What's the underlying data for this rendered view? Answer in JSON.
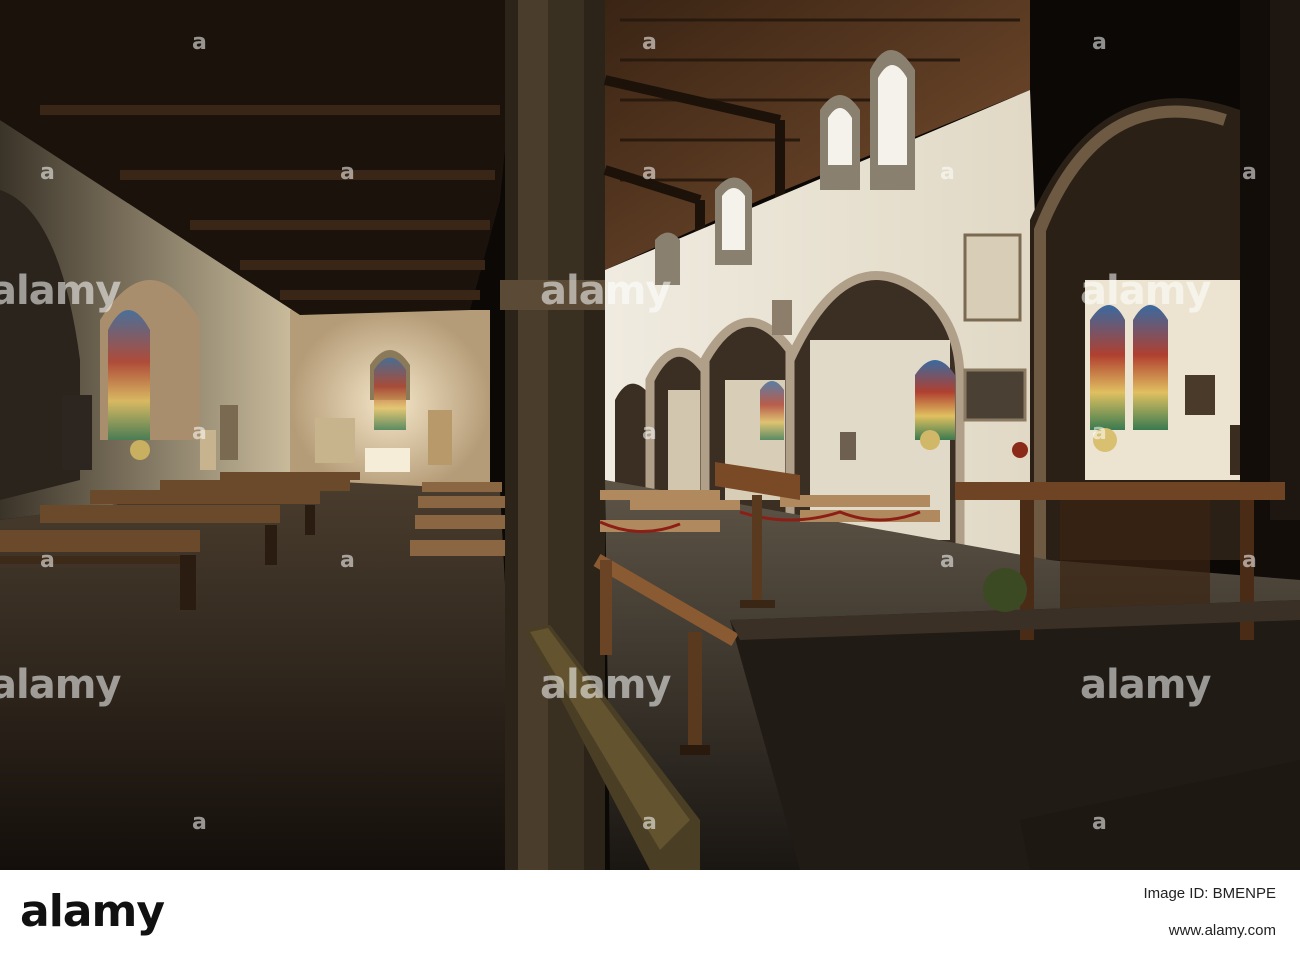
{
  "watermark": {
    "text": "alamy",
    "small_mark": "a"
  },
  "footer": {
    "logo": "alamy",
    "image_id_line": "Image ID: BMENPE",
    "url": "www.alamy.com"
  },
  "colors": {
    "footer_background": "#ffffff",
    "wall": "#e9e1cc",
    "wood": "#5a3a20"
  }
}
